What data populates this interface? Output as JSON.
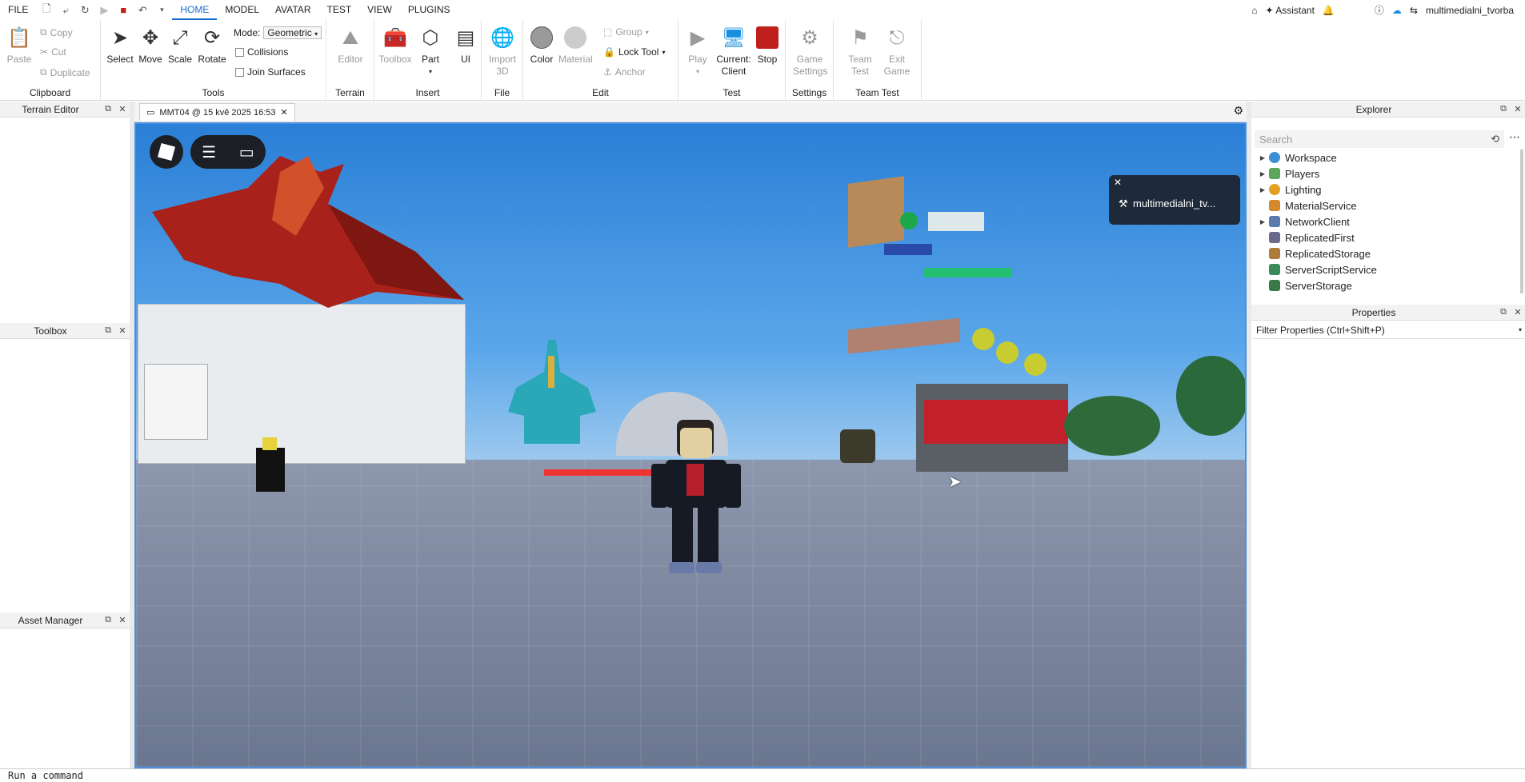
{
  "menubar": {
    "file": "FILE",
    "tabs": [
      "HOME",
      "MODEL",
      "AVATAR",
      "TEST",
      "VIEW",
      "PLUGINS"
    ],
    "assistant": "Assistant",
    "username": "multimedialni_tvorba"
  },
  "ribbon": {
    "clipboard": {
      "paste": "Paste",
      "copy": "Copy",
      "cut": "Cut",
      "duplicate": "Duplicate",
      "label": "Clipboard"
    },
    "tools": {
      "select": "Select",
      "move": "Move",
      "scale": "Scale",
      "rotate": "Rotate",
      "mode_label": "Mode:",
      "mode_value": "Geometric",
      "collisions": "Collisions",
      "join_surfaces": "Join Surfaces",
      "label": "Tools"
    },
    "terrain": {
      "editor": "Editor",
      "label": "Terrain"
    },
    "insert": {
      "toolbox": "Toolbox",
      "part": "Part",
      "ui": "UI",
      "label": "Insert"
    },
    "file": {
      "import3d_1": "Import",
      "import3d_2": "3D",
      "label": "File"
    },
    "edit": {
      "color": "Color",
      "material": "Material",
      "group": "Group",
      "lock_tool": "Lock Tool",
      "anchor": "Anchor",
      "label": "Edit"
    },
    "test": {
      "play": "Play",
      "current_1": "Current:",
      "current_2": "Client",
      "stop": "Stop",
      "label": "Test"
    },
    "settings": {
      "game_1": "Game",
      "game_2": "Settings",
      "label": "Settings"
    },
    "team_test": {
      "team_1": "Team",
      "team_2": "Test",
      "exit_1": "Exit",
      "exit_2": "Game",
      "label": "Team Test"
    }
  },
  "left_panels": {
    "terrain_editor": "Terrain Editor",
    "toolbox": "Toolbox",
    "asset_manager": "Asset Manager"
  },
  "doc_tab": {
    "title": "MMT04 @ 15 kvě 2025 16:53"
  },
  "viewport": {
    "notification_text": "multimedialni_tv..."
  },
  "explorer": {
    "title": "Explorer",
    "search_placeholder": "Search",
    "items": [
      {
        "label": "Workspace",
        "expandable": true,
        "color": "#3b8fd6"
      },
      {
        "label": "Players",
        "expandable": true,
        "color": "#5aa65a"
      },
      {
        "label": "Lighting",
        "expandable": true,
        "color": "#e0a020"
      },
      {
        "label": "MaterialService",
        "expandable": false,
        "color": "#d48a2a"
      },
      {
        "label": "NetworkClient",
        "expandable": true,
        "color": "#5a7ab0"
      },
      {
        "label": "ReplicatedFirst",
        "expandable": false,
        "color": "#6a6a8a"
      },
      {
        "label": "ReplicatedStorage",
        "expandable": false,
        "color": "#b07a3a"
      },
      {
        "label": "ServerScriptService",
        "expandable": false,
        "color": "#3a8a5a"
      },
      {
        "label": "ServerStorage",
        "expandable": false,
        "color": "#3a7a4a"
      }
    ]
  },
  "properties": {
    "title": "Properties",
    "filter_placeholder": "Filter Properties (Ctrl+Shift+P)"
  },
  "command_bar": {
    "placeholder": "Run a command"
  }
}
